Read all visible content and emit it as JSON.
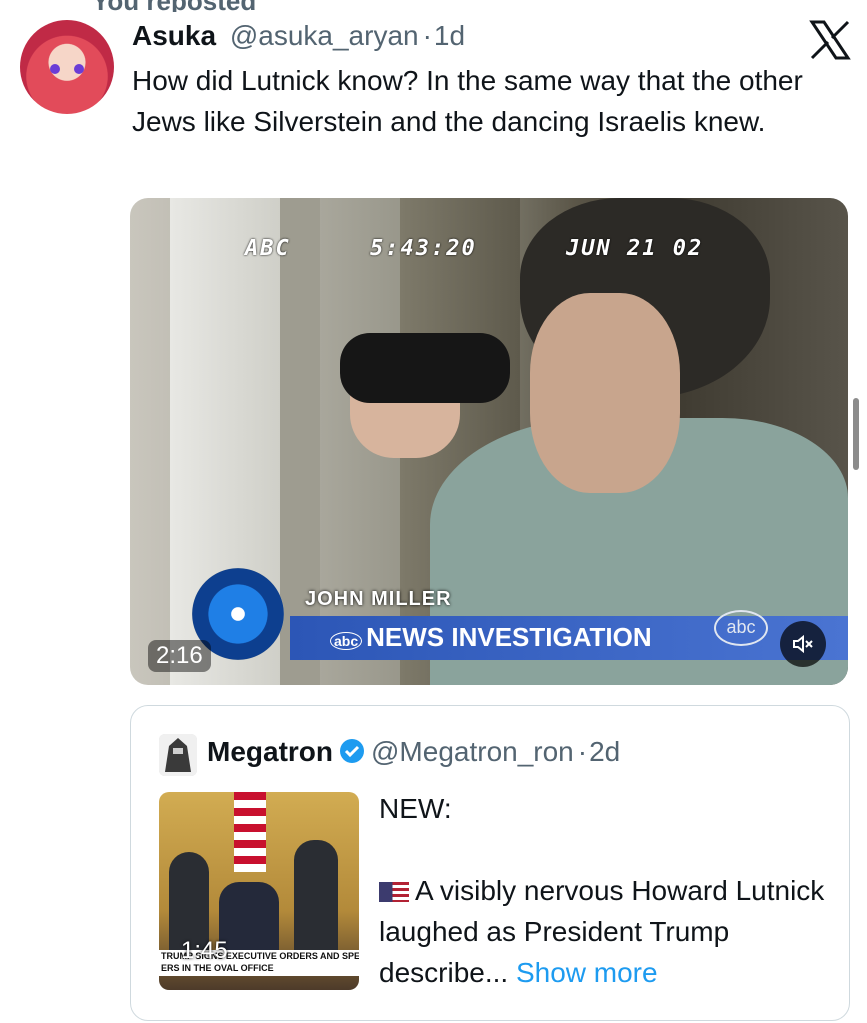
{
  "repost_banner": {
    "label": "You reposted"
  },
  "tweet": {
    "author_name": "Asuka",
    "author_handle": "@asuka_aryan",
    "separator": "·",
    "time": "1d",
    "text": "How did Lutnick know? In the same way that the other Jews like Silverstein and the dancing Israelis knew."
  },
  "video": {
    "osd_channel": "ABC",
    "osd_time": "5:43:20",
    "osd_date": "JUN 21 02",
    "lower_third_name": "JOHN MILLER",
    "lower_third_title": "NEWS INVESTIGATION",
    "lower_third_network": "abc",
    "corner_bug": "abc",
    "duration": "2:16",
    "mute_icon": "speaker-muted-icon"
  },
  "quoted": {
    "author_name": "Megatron",
    "author_handle": "@Megatron_ron",
    "separator": "·",
    "time": "2d",
    "line1": "NEW:",
    "body": "A visibly nervous Howard Lutnick laughed as President Trump describe...",
    "show_more": "Show more",
    "thumb_duration": "1:45",
    "thumb_caption_l1": "TRUMP SIGNS EXECUTIVE ORDERS AND SPE",
    "thumb_caption_l2": "ERS IN THE OVAL OFFICE"
  },
  "colors": {
    "text": "#0f1419",
    "secondary": "#536471",
    "link": "#1d9bf0",
    "border": "#cfd9de",
    "verified": "#1d9bf0"
  }
}
